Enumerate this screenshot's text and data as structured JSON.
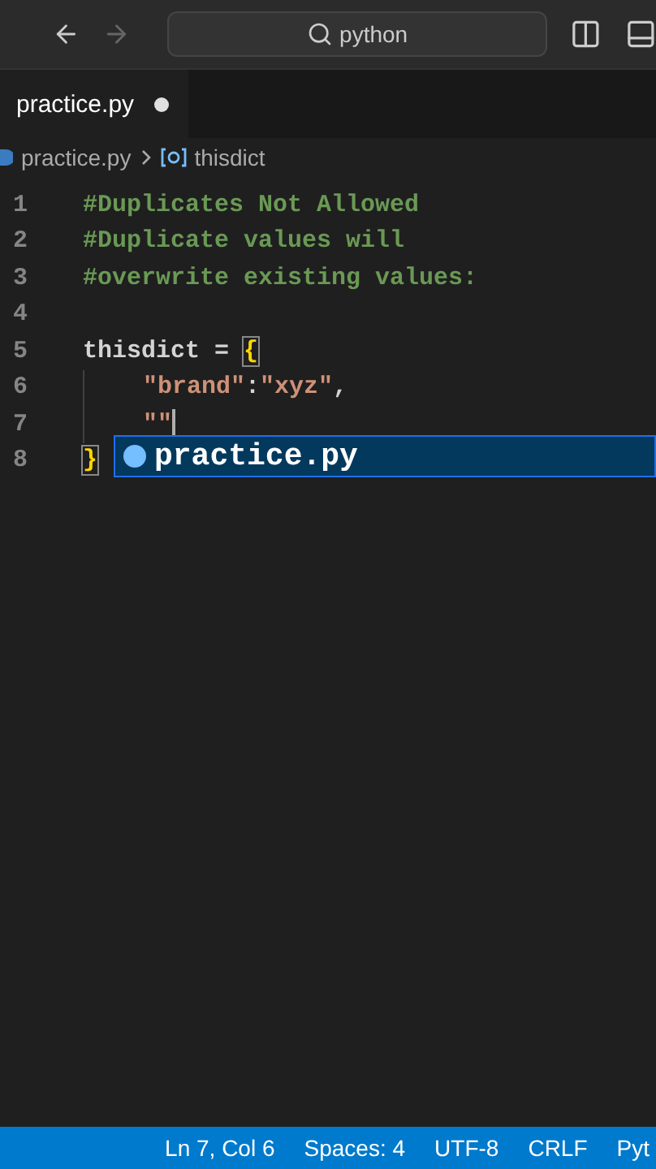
{
  "title_bar": {
    "search": "python"
  },
  "tabs": [
    {
      "label": "practice.py",
      "selected": true,
      "modified": true
    }
  ],
  "breadcrumb": [
    "practice.py",
    "thisdict"
  ],
  "editor": {
    "lines": [
      {
        "number": "1",
        "tokens": [
          {
            "kind": "comment",
            "text": "#Duplicates Not Allowed"
          }
        ]
      },
      {
        "number": "2",
        "tokens": [
          {
            "kind": "comment",
            "text": "#Duplicate values will"
          }
        ]
      },
      {
        "number": "3",
        "tokens": [
          {
            "kind": "comment",
            "text": "#overwrite existing values:"
          }
        ]
      },
      {
        "number": "4"
      },
      {
        "number": "5",
        "tokens": [
          {
            "kind": "plain",
            "text": "thisdict = "
          },
          {
            "kind": "bracket",
            "text": "{"
          }
        ]
      },
      {
        "number": "6",
        "indent": true,
        "tokens": [
          {
            "kind": "string",
            "text": "\"brand\""
          },
          {
            "kind": "plain",
            "text": ":"
          },
          {
            "kind": "string",
            "text": "\"xyz\""
          },
          {
            "kind": "plain",
            "text": ","
          }
        ]
      },
      {
        "number": "7",
        "indent": true,
        "cursor": true,
        "tokens": [
          {
            "kind": "string",
            "text": "\"\""
          }
        ]
      },
      {
        "number": "8",
        "tokens": [
          {
            "kind": "bracket",
            "text": "}"
          }
        ]
      }
    ]
  },
  "suggestion": {
    "label": "practice.py",
    "selected": true
  },
  "status_bar": [
    "Ln 7, Col 6",
    "Spaces: 4",
    "UTF-8",
    "CRLF",
    "Pyt"
  ]
}
